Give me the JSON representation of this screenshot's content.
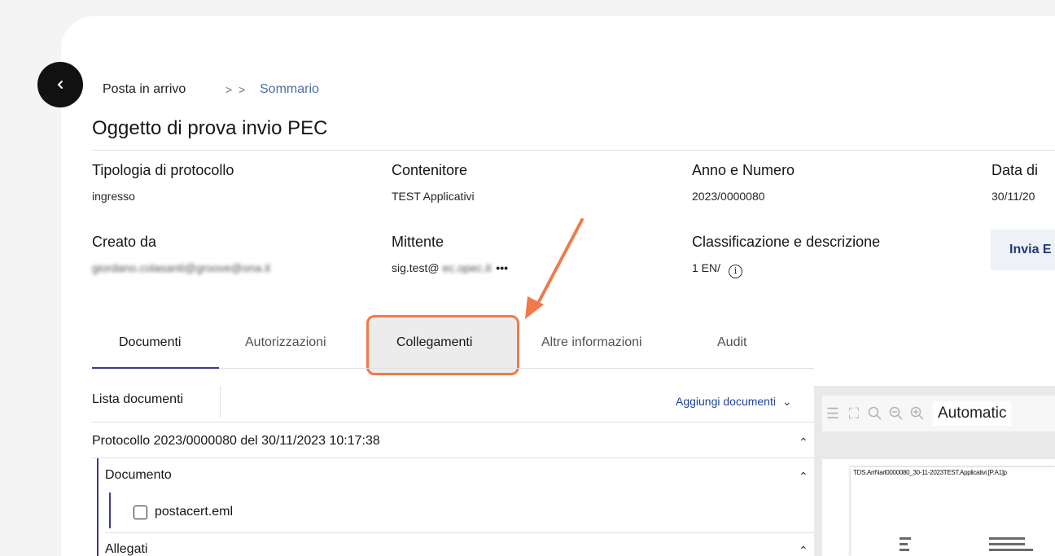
{
  "breadcrumb": {
    "home": "Posta in arrivo",
    "separator": "> >",
    "current": "Sommario"
  },
  "title": "Oggetto di prova invio PEC",
  "fields": {
    "tipologia": {
      "label": "Tipologia di protocollo",
      "value": "ingresso"
    },
    "contenitore": {
      "label": "Contenitore",
      "value": "TEST Applicativi"
    },
    "anno": {
      "label": "Anno e Numero",
      "value": "2023/0000080"
    },
    "data": {
      "label": "Data di",
      "value": "30/11/20"
    },
    "creato": {
      "label": "Creato da",
      "value": "giordano.colasanti@groove@ona.it"
    },
    "mittente": {
      "label": "Mittente",
      "value": "sig.test@",
      "value_blur": "ec.opec.it",
      "more": "•••"
    },
    "classificazione": {
      "label": "Classificazione e descrizione",
      "value": "1 EN/",
      "info_icon": "info-icon"
    }
  },
  "actions": {
    "invia": "Invia E"
  },
  "tabs": [
    {
      "label": "Documenti",
      "active": true
    },
    {
      "label": "Autorizzazioni",
      "active": false
    },
    {
      "label": "Collegamenti",
      "active": false,
      "highlighted": true
    },
    {
      "label": "Altre informazioni",
      "active": false
    },
    {
      "label": "Audit",
      "active": false
    }
  ],
  "documents": {
    "list_title": "Lista documenti",
    "add_label": "Aggiungi documenti",
    "protocol_row": "Protocollo 2023/0000080 del 30/11/2023 10:17:38",
    "documento_label": "Documento",
    "file_name": "postacert.eml",
    "allegati_label": "Allegati"
  },
  "viewer": {
    "zoom": "Automatic",
    "page_header": "TDS.ArrNarl0000080_30-11-2023TEST.Applicativi.[P.A1]p"
  },
  "colors": {
    "accent": "#3a3a8a",
    "link": "#2043a0",
    "highlight": "#f07a4a"
  }
}
